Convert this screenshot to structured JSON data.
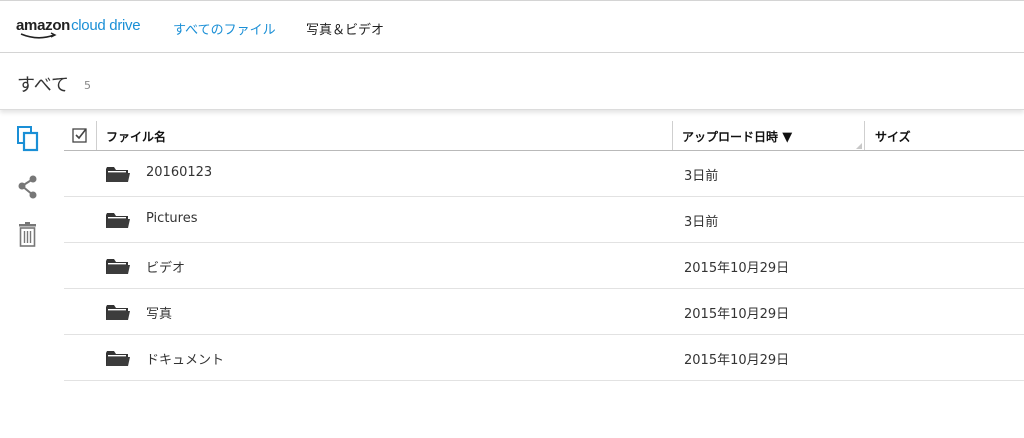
{
  "app": {
    "logo_amazon": "amazon",
    "logo_cloud_drive": "cloud drive",
    "accent_color": "#1a8fd6"
  },
  "nav": {
    "links": [
      {
        "label": "すべてのファイル",
        "active": true
      },
      {
        "label": "写真＆ビデオ",
        "active": false
      }
    ]
  },
  "breadcrumb": {
    "title": "すべて",
    "count": "5"
  },
  "sidebar_actions": [
    {
      "icon": "copy-icon"
    },
    {
      "icon": "share-icon"
    },
    {
      "icon": "trash-icon"
    }
  ],
  "table": {
    "columns": {
      "name": "ファイル名",
      "uploaded": "アップロード日時",
      "size": "サイズ"
    },
    "sort_indicator": "▼",
    "rows": [
      {
        "name": "20160123",
        "uploaded": "3日前",
        "size": ""
      },
      {
        "name": "Pictures",
        "uploaded": "3日前",
        "size": ""
      },
      {
        "name": "ビデオ",
        "uploaded": "2015年10月29日",
        "size": ""
      },
      {
        "name": "写真",
        "uploaded": "2015年10月29日",
        "size": ""
      },
      {
        "name": "ドキュメント",
        "uploaded": "2015年10月29日",
        "size": ""
      }
    ]
  }
}
